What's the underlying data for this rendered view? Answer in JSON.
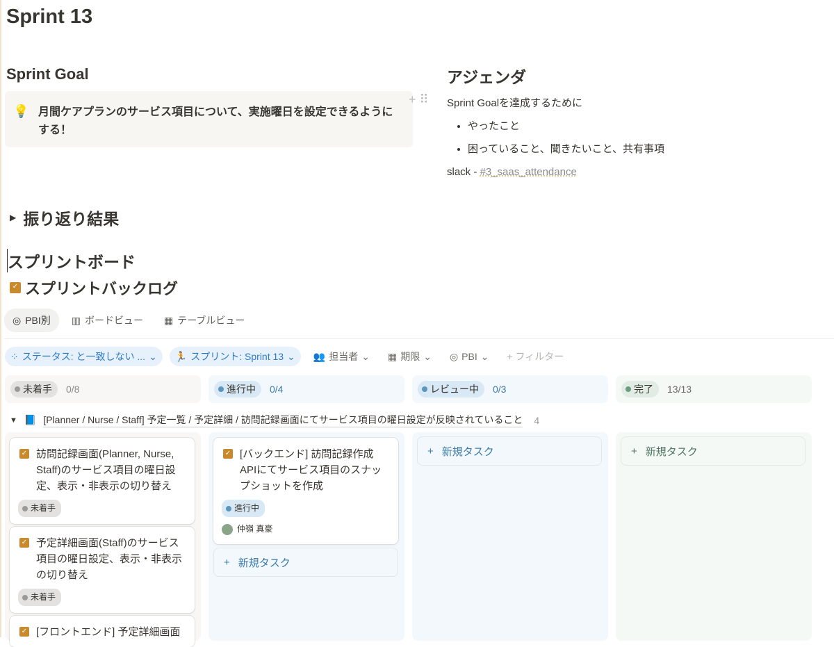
{
  "title": "Sprint 13",
  "goal": {
    "heading": "Sprint Goal",
    "text": "月間ケアプランのサービス項目について、実施曜日を設定できるようにする！"
  },
  "agenda": {
    "heading": "アジェンダ",
    "intro": "Sprint Goalを達成するために",
    "items": [
      "やったこと",
      "困っていること、聞きたいこと、共有事項"
    ],
    "slack_prefix": "slack - ",
    "slack_link": "#3_saas_attendance"
  },
  "retro": "振り返り結果",
  "board_heading": "スプリントボード",
  "db_title": "スプリントバックログ",
  "tabs": [
    "PBI別",
    "ボードビュー",
    "テーブルビュー"
  ],
  "filters": {
    "status": "ステータス: と一致しない ...",
    "sprint": "スプリント: Sprint 13",
    "assignee": "担当者",
    "due": "期限",
    "pbi": "PBI",
    "add": "+ フィルター"
  },
  "columns": [
    {
      "label": "未着手",
      "count": "0/8",
      "color": "#9b9a97"
    },
    {
      "label": "進行中",
      "count": "0/4",
      "color": "#5b97bd"
    },
    {
      "label": "レビュー中",
      "count": "0/3",
      "color": "#5b97bd"
    },
    {
      "label": "完了",
      "count": "13/13",
      "color": "#6c9b7d"
    }
  ],
  "group": {
    "title": "[Planner / Nurse / Staff] 予定一覧 / 予定詳細 / 訪問記録画面にてサービス項目の曜日設定が反映されていること",
    "count": "4"
  },
  "cards": [
    {
      "title": "訪問記録画面(Planner, Nurse, Staff)のサービス項目の曜日設定、表示・非表示の切り替え",
      "status": "未着手"
    },
    {
      "title": "予定詳細画面(Staff)のサービス項目の曜日設定、表示・非表示の切り替え",
      "status": "未着手"
    },
    {
      "title": "[フロントエンド] 予定詳細画面"
    },
    {
      "title": "[バックエンド] 訪問記録作成APIにてサービス項目のスナップショットを作成",
      "status": "進行中",
      "assignee": "仲嶺 真豪"
    }
  ],
  "new_task": "新規タスク"
}
